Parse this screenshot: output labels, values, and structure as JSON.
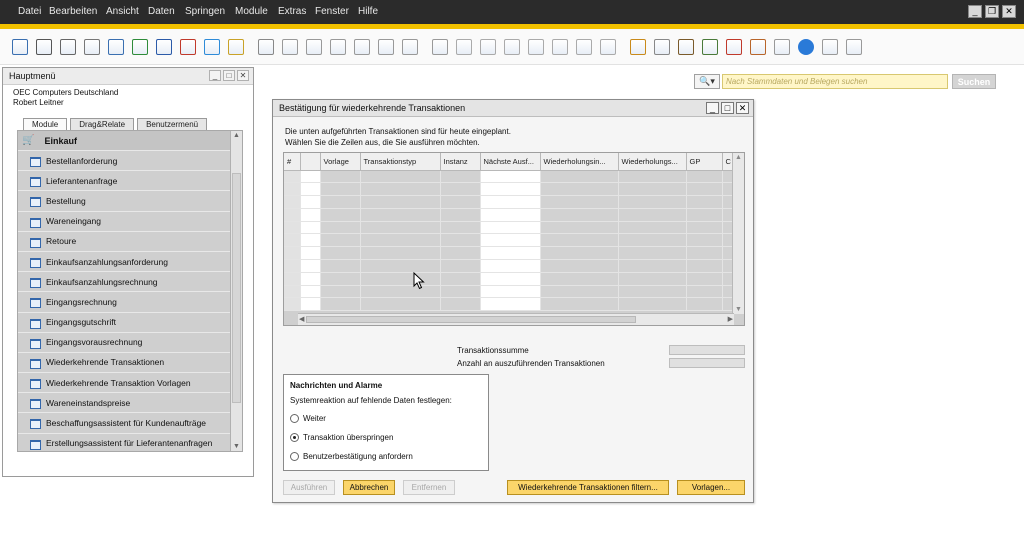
{
  "menubar": {
    "items": [
      "Datei",
      "Bearbeiten",
      "Ansicht",
      "Daten",
      "Springen",
      "Module",
      "Extras",
      "Fenster",
      "Hilfe"
    ],
    "window_buttons": [
      "minimize-icon",
      "restore-icon",
      "close-icon"
    ]
  },
  "search": {
    "placeholder": "Nach Stammdaten und Belegen suchen",
    "button_label": "Suchen"
  },
  "main_menu": {
    "title": "Hauptmenü",
    "company": "OEC Computers Deutschland",
    "user": "Robert Leitner",
    "tabs": [
      "Module",
      "Drag&Relate",
      "Benutzermenü"
    ],
    "active_tab": "Module",
    "category": "Einkauf",
    "items": [
      "Bestellanforderung",
      "Lieferantenanfrage",
      "Bestellung",
      "Wareneingang",
      "Retoure",
      "Einkaufsanzahlungsanforderung",
      "Einkaufsanzahlungsrechnung",
      "Eingangsrechnung",
      "Eingangsgutschrift",
      "Eingangsvorausrechnung",
      "Wiederkehrende Transaktionen",
      "Wiederkehrende Transaktion Vorlagen",
      "Wareneinstandspreise",
      "Beschaffungsassistent für Kundenaufträge",
      "Erstellungsassistent für Lieferantenanfragen"
    ]
  },
  "dialog": {
    "title": "Bestätigung für wiederkehrende Transaktionen",
    "intro_line1": "Die unten aufgeführten Transaktionen sind für heute eingeplant.",
    "intro_line2": "Wählen Sie die Zeilen aus, die Sie ausführen möchten.",
    "table": {
      "columns": [
        "#",
        "",
        "Vorlage",
        "Transaktionstyp",
        "Instanz",
        "Nächste Ausf...",
        "Wiederholungsin...",
        "Wiederholungs...",
        "GP",
        "C"
      ],
      "rows": 11
    },
    "summary": {
      "total_label": "Transaktionssumme",
      "count_label": "Anzahl an auszuführenden Transaktionen",
      "total_value": "",
      "count_value": ""
    },
    "group": {
      "title": "Nachrichten und Alarme",
      "subtitle": "Systemreaktion auf fehlende Daten festlegen:",
      "options": [
        "Weiter",
        "Transaktion überspringen",
        "Benutzerbestätigung anfordern"
      ],
      "selected": "Transaktion überspringen"
    },
    "buttons": {
      "execute": "Ausführen",
      "cancel": "Abbrechen",
      "remove": "Entfernen",
      "filter": "Wiederkehrende Transaktionen filtern...",
      "templates": "Vorlagen..."
    }
  },
  "colors": {
    "menubar_bg": "#2b2b2b",
    "accent": "#f2c100",
    "button_yellow": "#fbd56a",
    "search_field": "#fff6c8"
  },
  "toolbar_icons": [
    "preview-icon",
    "print-icon",
    "email-icon",
    "fax-icon",
    "export-icon",
    "excel-icon",
    "word-icon",
    "pdf-icon",
    "launch-icon",
    "lock-icon",
    "find-icon",
    "add-icon",
    "first-icon",
    "previous-icon",
    "next-icon",
    "last-icon",
    "filter-icon",
    "sort-icon",
    "base-document-icon",
    "target-document-icon",
    "gross-profit-icon",
    "payment-icon",
    "volume-icon",
    "transaction-journal-icon",
    "query-icon",
    "edit-icon",
    "settings-icon",
    "form-settings-icon",
    "messages-icon",
    "alerts-icon",
    "calendar-icon",
    "org-chart-icon",
    "help-icon",
    "sap-icon-1",
    "sap-icon-2"
  ]
}
